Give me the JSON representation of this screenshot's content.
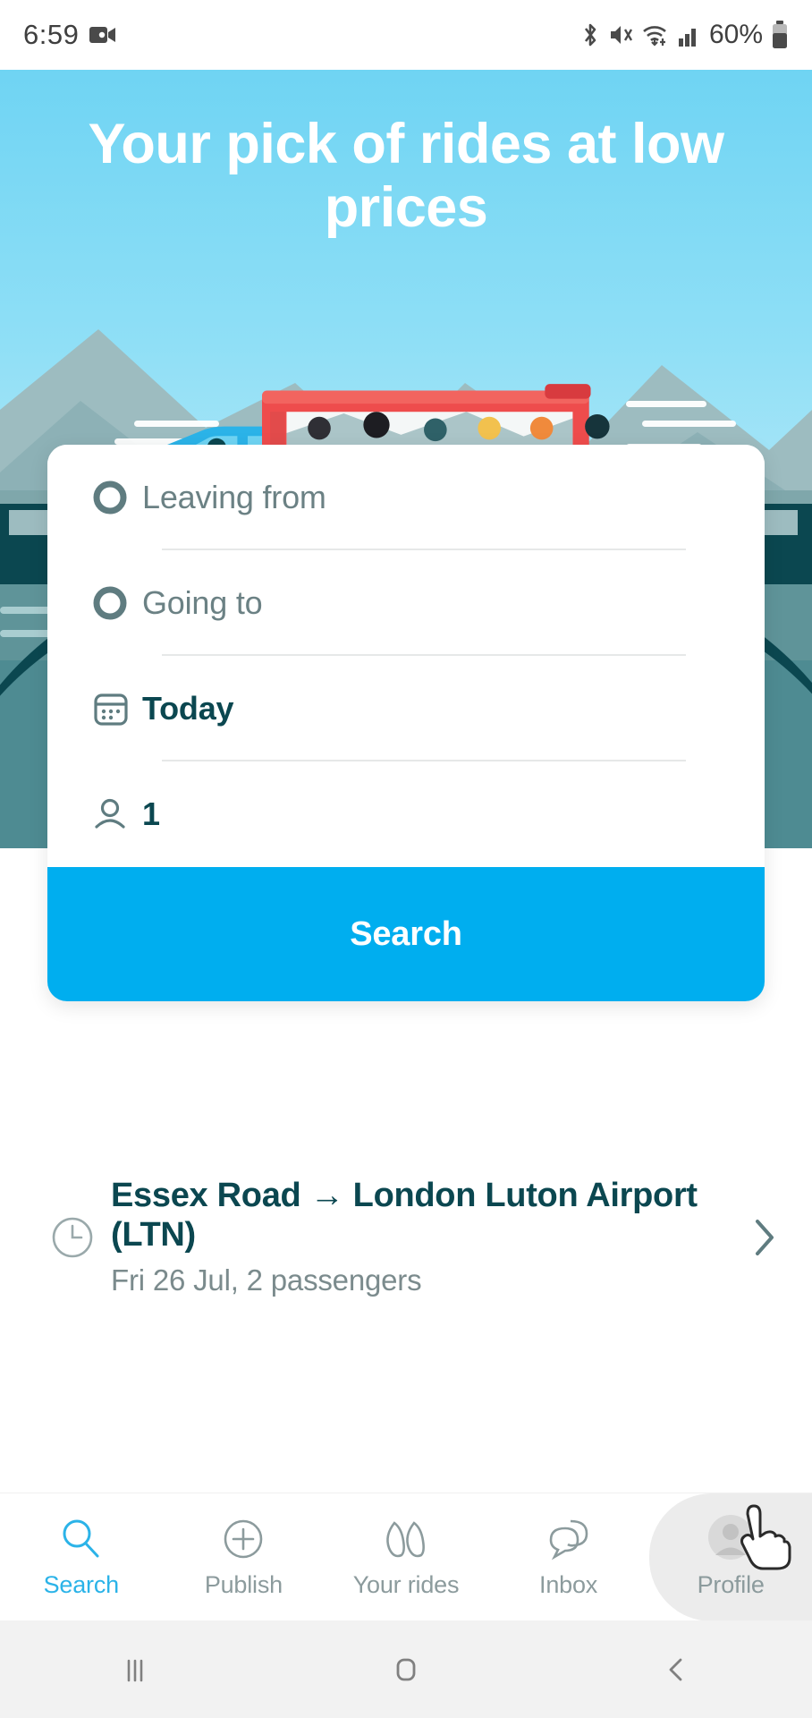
{
  "status_bar": {
    "time": "6:59",
    "battery_percent": "60%",
    "icons": [
      "video-camera-icon",
      "bluetooth-icon",
      "vibrate-mute-icon",
      "wifi-icon",
      "signal-bars-icon",
      "battery-icon"
    ]
  },
  "hero": {
    "title": "Your pick of rides at low prices",
    "illustration": "car-and-bus-on-bridge-illustration",
    "sky_color": "#8fdff6",
    "bridge_color": "#0b4750",
    "car_color": "#2bb3e8",
    "bus_color": "#ee4c4c"
  },
  "search_card": {
    "leaving_from": {
      "icon": "circle-outline-icon",
      "placeholder": "Leaving from",
      "value": ""
    },
    "going_to": {
      "icon": "circle-outline-icon",
      "placeholder": "Going to",
      "value": ""
    },
    "date": {
      "icon": "calendar-icon",
      "value": "Today"
    },
    "passengers": {
      "icon": "person-icon",
      "value": "1"
    },
    "search_button": {
      "label": "Search",
      "color": "#00aeef"
    }
  },
  "recent_search": {
    "icon": "clock-icon",
    "title": "Essex Road → London Luton Airport (LTN)",
    "subtitle": "Fri 26 Jul, 2 passengers",
    "chevron": "chevron-right-icon"
  },
  "bottom_nav": {
    "active_color": "#2bb3e8",
    "items": [
      {
        "label": "Search",
        "icon": "magnifier-icon",
        "active": true,
        "pressed": false
      },
      {
        "label": "Publish",
        "icon": "plus-circle-icon",
        "active": false,
        "pressed": false
      },
      {
        "label": "Your rides",
        "icon": "two-ovals-icon",
        "active": false,
        "pressed": false
      },
      {
        "label": "Inbox",
        "icon": "speech-bubble-icon",
        "active": false,
        "pressed": false
      },
      {
        "label": "Profile",
        "icon": "avatar-icon",
        "active": false,
        "pressed": true
      }
    ]
  },
  "android_nav": {
    "recents": "recents-icon",
    "home": "home-icon",
    "back": "back-icon"
  }
}
